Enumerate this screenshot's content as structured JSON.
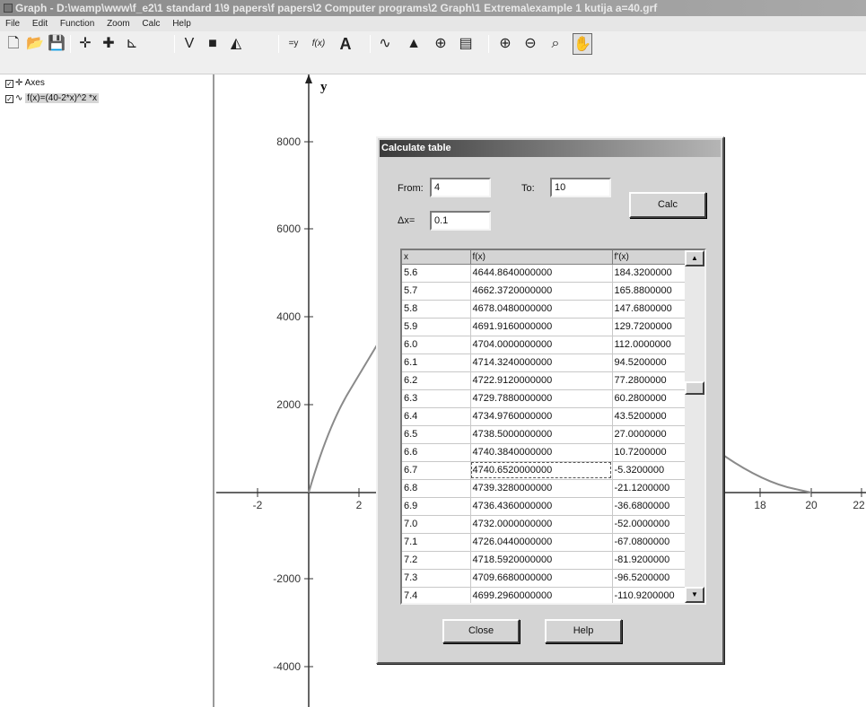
{
  "window": {
    "title": "Graph - D:\\wamp\\www\\f_e2\\1 standard 1\\9 papers\\f papers\\2 Computer programs\\2 Graph\\1 Extrema\\example 1 kutija a=40.grf"
  },
  "menu": [
    "File",
    "Edit",
    "Function",
    "Zoom",
    "Calc",
    "Help"
  ],
  "toolbar": {
    "icons": [
      "new-file-icon",
      "open-icon",
      "save-icon",
      "axes-icon",
      "insert-point-icon",
      "point-series-icon",
      "tangent-icon",
      "shade-icon",
      "series-icon",
      "relation-icon",
      "function-icon",
      "text-label-icon",
      "evaluate-icon",
      "area-icon",
      "table-tool-icon",
      "calc-table-icon",
      "zoom-in-icon",
      "zoom-out-icon",
      "zoom-fit-icon",
      "move-hand-icon"
    ],
    "glyphs": [
      "🗋",
      "📂",
      "💾",
      "✛",
      "✚",
      "⊾",
      "V",
      "■",
      "◭",
      "=y",
      "f(x)",
      "A",
      "∿",
      "▲",
      "⊕",
      "▤",
      "⊕",
      "⊖",
      "⌕",
      "✋"
    ]
  },
  "left_panel": {
    "items": [
      {
        "label": "Axes",
        "checked": true
      },
      {
        "label": "f(x)=(40-2*x)^2 *x",
        "checked": true
      }
    ]
  },
  "graph": {
    "y_axis_label": "y",
    "x_ticks": [
      "-2",
      "2",
      "18",
      "20",
      "22"
    ],
    "y_ticks": [
      "8000",
      "6000",
      "4000",
      "2000",
      "-2000",
      "-4000"
    ]
  },
  "dialog": {
    "title": "Calculate table",
    "from_label": "From:",
    "from_value": "4",
    "to_label": "To:",
    "to_value": "10",
    "dx_label": "Δx=",
    "dx_value": "0.1",
    "calc_button": "Calc",
    "close_button": "Close",
    "help_button": "Help",
    "table": {
      "headers": [
        "x",
        "f(x)",
        "f'(x)"
      ],
      "selected_row": 11,
      "rows": [
        [
          "5.6",
          "4644.8640000000",
          "184.3200000"
        ],
        [
          "5.7",
          "4662.3720000000",
          "165.8800000"
        ],
        [
          "5.8",
          "4678.0480000000",
          "147.6800000"
        ],
        [
          "5.9",
          "4691.9160000000",
          "129.7200000"
        ],
        [
          "6.0",
          "4704.0000000000",
          "112.0000000"
        ],
        [
          "6.1",
          "4714.3240000000",
          "94.5200000"
        ],
        [
          "6.2",
          "4722.9120000000",
          "77.2800000"
        ],
        [
          "6.3",
          "4729.7880000000",
          "60.2800000"
        ],
        [
          "6.4",
          "4734.9760000000",
          "43.5200000"
        ],
        [
          "6.5",
          "4738.5000000000",
          "27.0000000"
        ],
        [
          "6.6",
          "4740.3840000000",
          "10.7200000"
        ],
        [
          "6.7",
          "4740.6520000000",
          "-5.3200000"
        ],
        [
          "6.8",
          "4739.3280000000",
          "-21.1200000"
        ],
        [
          "6.9",
          "4736.4360000000",
          "-36.6800000"
        ],
        [
          "7.0",
          "4732.0000000000",
          "-52.0000000"
        ],
        [
          "7.1",
          "4726.0440000000",
          "-67.0800000"
        ],
        [
          "7.2",
          "4718.5920000000",
          "-81.9200000"
        ],
        [
          "7.3",
          "4709.6680000000",
          "-96.5200000"
        ],
        [
          "7.4",
          "4699.2960000000",
          "-110.9200000"
        ]
      ]
    }
  }
}
